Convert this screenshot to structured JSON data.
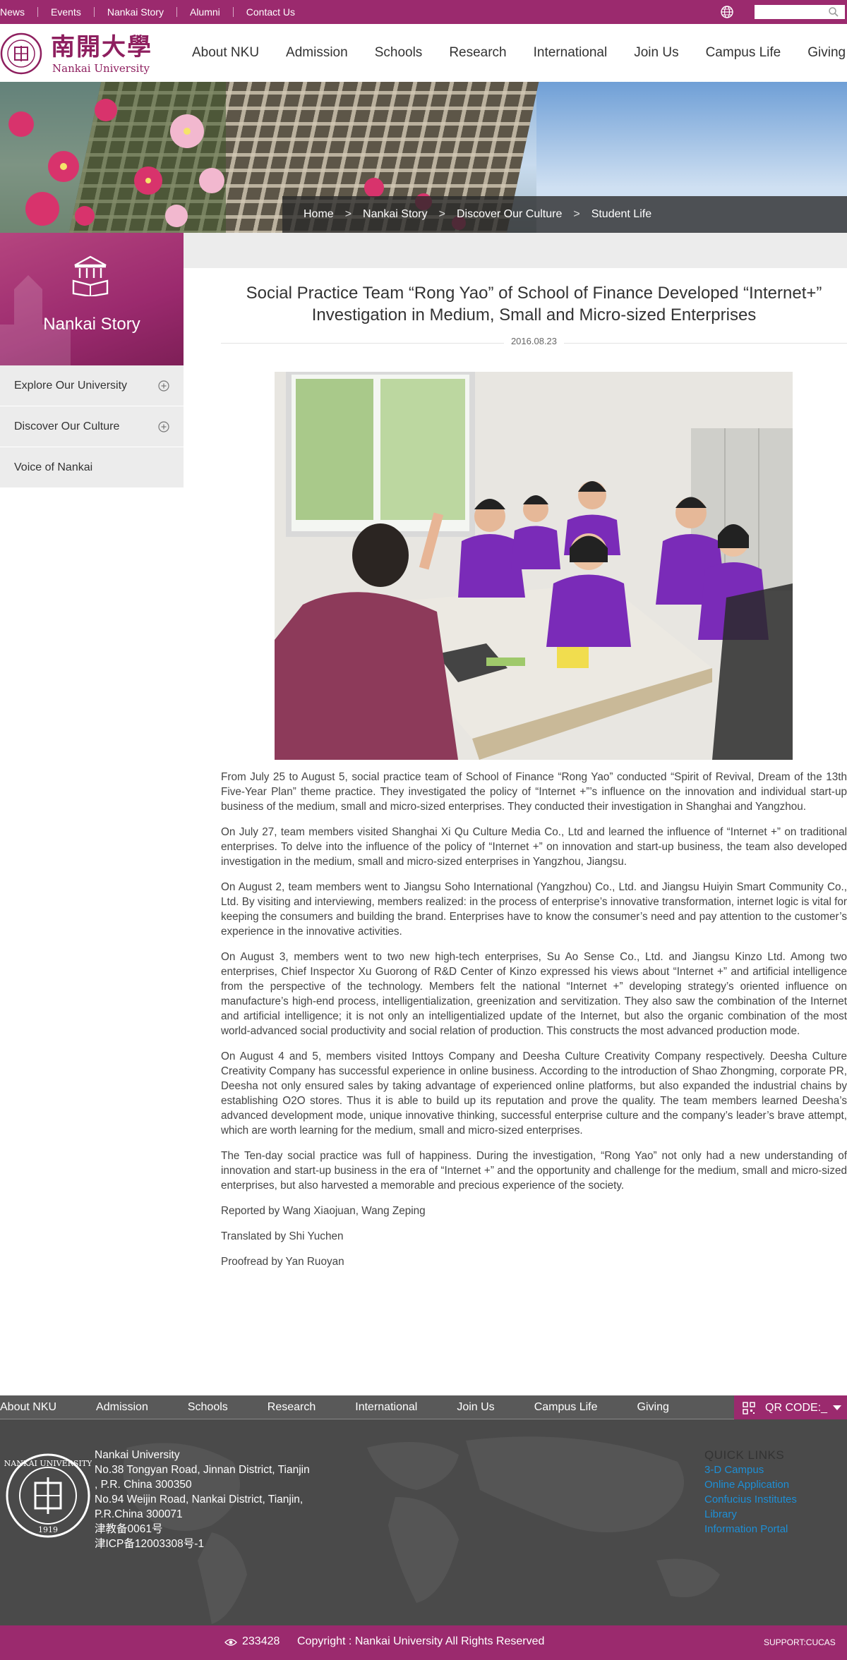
{
  "topbar": {
    "links": [
      "News",
      "Events",
      "Nankai Story",
      "Alumni",
      "Contact Us"
    ],
    "search_placeholder": ""
  },
  "header": {
    "logo_cn": "南開大學",
    "logo_en": "Nankai University",
    "nav": [
      "About NKU",
      "Admission",
      "Schools",
      "Research",
      "International",
      "Join Us",
      "Campus Life",
      "Giving"
    ]
  },
  "breadcrumb": {
    "items": [
      "Home",
      "Nankai Story",
      "Discover Our Culture",
      "Student Life"
    ],
    "separator": ">"
  },
  "sidebar": {
    "title": "Nankai Story",
    "items": [
      {
        "label": "Explore Our University",
        "expandable": true
      },
      {
        "label": "Discover Our Culture",
        "expandable": true
      },
      {
        "label": "Voice of Nankai",
        "expandable": false
      }
    ]
  },
  "article": {
    "title": "Social Practice Team “Rong Yao” of School of Finance Developed “Internet+” Investigation in Medium, Small and Micro-sized Enterprises",
    "date": "2016.08.23",
    "paragraphs": [
      "From July 25 to August 5, social practice team of School of Finance “Rong Yao” conducted “Spirit of Revival, Dream of the 13th Five-Year Plan” theme practice. They investigated the policy of “Internet +”’s influence on the innovation and individual start-up business of the medium, small and micro-sized enterprises. They conducted their investigation in Shanghai and Yangzhou.",
      "On July 27, team members visited Shanghai Xi Qu Culture Media Co., Ltd and learned the influence of “Internet +” on traditional enterprises. To delve into the influence of the policy of “Internet +” on innovation and start-up business, the team also developed investigation in the medium, small and micro-sized enterprises in Yangzhou, Jiangsu.",
      "On August 2, team members went to Jiangsu Soho International (Yangzhou) Co., Ltd. and Jiangsu Huiyin Smart Community Co., Ltd. By visiting and interviewing, members realized: in the process of enterprise’s innovative transformation, internet logic is vital for keeping the consumers and building the brand. Enterprises have to know the consumer’s need and pay attention to the customer’s experience in the innovative activities.",
      "On August 3, members went to two new high-tech enterprises, Su Ao Sense Co., Ltd. and Jiangsu Kinzo Ltd. Among two enterprises, Chief Inspector Xu Guorong of R&D Center of Kinzo expressed his views about “Internet +” and artificial intelligence from the perspective of the technology. Members felt the national “Internet +” developing strategy’s oriented influence on manufacture’s high-end process, intelligentialization, greenization and servitization. They also saw the combination of the Internet and artificial intelligence; it is not only an intelligentialized update of the Internet, but also the organic combination of the most world-advanced social productivity and social relation of production. This constructs the most advanced production mode.",
      "On August 4 and 5, members visited Inttoys Company and Deesha Culture Creativity Company respectively. Deesha Culture Creativity Company has successful experience in online business. According to the introduction of Shao Zhongming, corporate PR, Deesha not only ensured sales by taking advantage of experienced online platforms, but also expanded the industrial chains by establishing O2O stores. Thus it is able to build up its reputation and prove the quality. The team members learned Deesha’s advanced development mode, unique innovative thinking, successful enterprise culture and the company’s leader’s brave attempt, which are worth learning for the medium, small and micro-sized enterprises.",
      "The Ten-day social practice was full of happiness. During the investigation, “Rong Yao” not only had a new understanding of innovation and start-up business in the era of “Internet +” and the opportunity and challenge for the medium, small and micro-sized enterprises, but also harvested a memorable and precious experience of the society.",
      "Reported by Wang Xiaojuan, Wang Zeping",
      "Translated by Shi Yuchen",
      "Proofread by Yan Ruoyan"
    ]
  },
  "footer": {
    "nav": [
      "About NKU",
      "Admission",
      "Schools",
      "Research",
      "International",
      "Join Us",
      "Campus Life",
      "Giving"
    ],
    "qr_label": "QR CODE:_",
    "address_lines": [
      "Nankai University",
      "No.38 Tongyan Road, Jinnan District, Tianjin",
      ", P.R. China 300350",
      "No.94 Weijin Road,   Nankai District, Tianjin,",
      "P.R.China  300071",
      "津教备0061号",
      "津ICP备12003308号-1"
    ],
    "quick_links_title": "QUICK LINKS",
    "quick_links": [
      "3-D Campus",
      "Online Application",
      "Confucius Institutes",
      "Library",
      "Information Portal"
    ],
    "visit_count": "233428",
    "copyright": "Copyright : Nankai University All Rights Reserved",
    "support": "SUPPORT:CUCAS"
  },
  "colors": {
    "brand": "#9b2a6e",
    "link": "#1d8fd6",
    "footer_bg": "#4a4a4a"
  }
}
